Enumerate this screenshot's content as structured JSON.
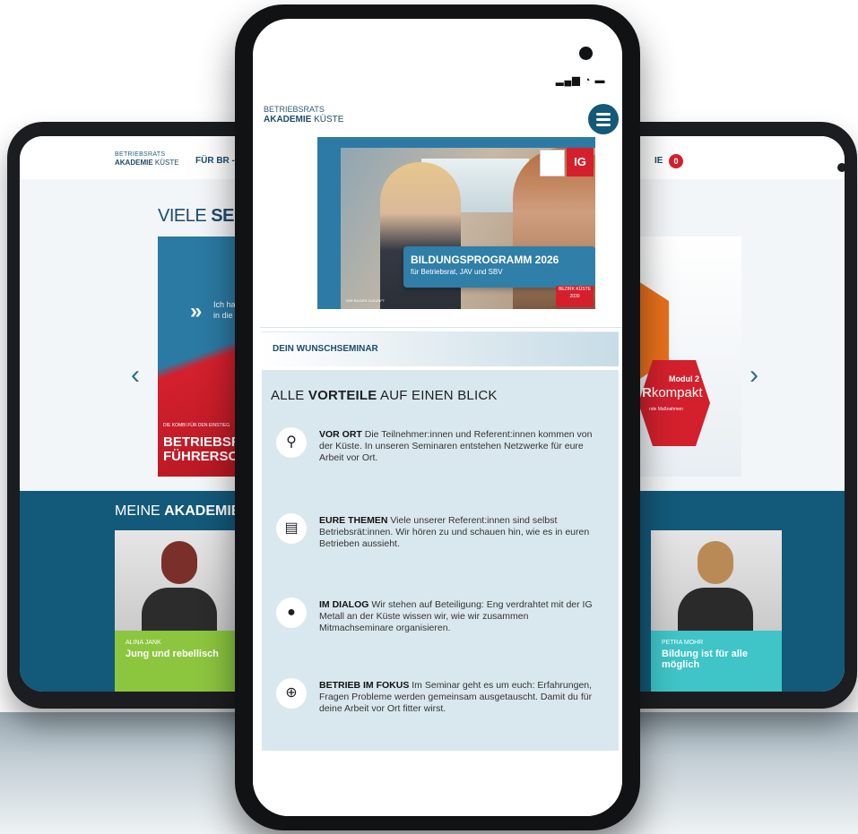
{
  "tablet": {
    "logo_line1": "BETRIEBSRATS",
    "logo_line2_bold": "AKADEMIE",
    "logo_line2_thin": "KÜSTE",
    "nav_left": "FÜR BR - JA",
    "nav_right": "IE",
    "nav_badge": "0",
    "heading_normal": "VIELE",
    "heading_bold": "SEMI",
    "slide_left": {
      "quote_mark": "»",
      "quote_text_1": "Ich ha",
      "quote_text_2": "in die",
      "small_text": "DIE KOMBI FÜR DEN EINSTIEG",
      "big_text_1": "BETRIEBSR",
      "big_text_2": "FÜHRERSCI"
    },
    "slide_right": {
      "modul": "Modul 2",
      "kompakt_bold": "R",
      "kompakt_normal": "kompakt",
      "subtext": "nde Maßnahmen"
    },
    "arrow_left": "‹",
    "arrow_right": "›",
    "band_heading_normal": "MEINE",
    "band_heading_bold": "AKADEMIE",
    "cards": [
      {
        "name": "ALINA JANK",
        "text": "Jung und rebellisch",
        "caption_color": "#8cc63f",
        "shirt_color": "#2c2c2c",
        "hair_color": "#7a2f2a"
      },
      {
        "name": "PETRA MOHR",
        "text": "Bildung ist für alle möglich",
        "caption_color": "#3fc4c7",
        "shirt_color": "#2a2a2a",
        "hair_color": "#b98a56"
      }
    ]
  },
  "phone": {
    "status_icons": "▂▄▆ ◔ ▬",
    "logo_line1": "BETRIEBSRATS",
    "logo_line2_bold": "AKADEMIE",
    "logo_line2_thin": "KÜSTE",
    "menu_icon": "hamburger-menu-icon",
    "hero": {
      "title": "BILDUNGSPROGRAMM 2026",
      "subtitle": "für Betriebsrat, JAV und SBV",
      "fine_print": "WIR BILDEN ZUKUNFT",
      "logo_letter": "IG",
      "year_badge": "BEZIRK KÜSTE 2030"
    },
    "wunsch_label": "DEIN WUNSCHSEMINAR",
    "advantages": {
      "heading_pre": "ALLE",
      "heading_bold": "VORTEILE",
      "heading_post": "AUF EINEN BLICK",
      "items": [
        {
          "icon": "location-pin-icon",
          "glyph": "⚲",
          "title": "VOR ORT",
          "text": "Die Teilnehmer:innen und Referent:innen kommen von der Küste. In unseren Seminaren entstehen Netzwerke für eure Arbeit vor Ort."
        },
        {
          "icon": "clipboard-icon",
          "glyph": "▤",
          "title": "EURE THEMEN",
          "text": "Viele unserer Referent:innen sind selbst Betriebsrät:innen. Wir hören zu und schauen hin, wie es in euren Betrieben aussieht."
        },
        {
          "icon": "chat-bubbles-icon",
          "glyph": "●",
          "title": "IM DIALOG",
          "text": "Wir stehen auf Beteiligung: Eng verdrahtet mit der IG Metall an der Küste wissen wir, wie wir zusammen Mitmachseminare organisieren."
        },
        {
          "icon": "magnifier-plus-icon",
          "glyph": "⊕",
          "title": "BETRIEB IM FOKUS",
          "text": "Im Seminar geht es um euch: Erfahrungen, Fragen Probleme werden gemeinsam ausgetauscht. Damit du für deine Arbeit vor Ort fitter wirst."
        }
      ]
    }
  }
}
